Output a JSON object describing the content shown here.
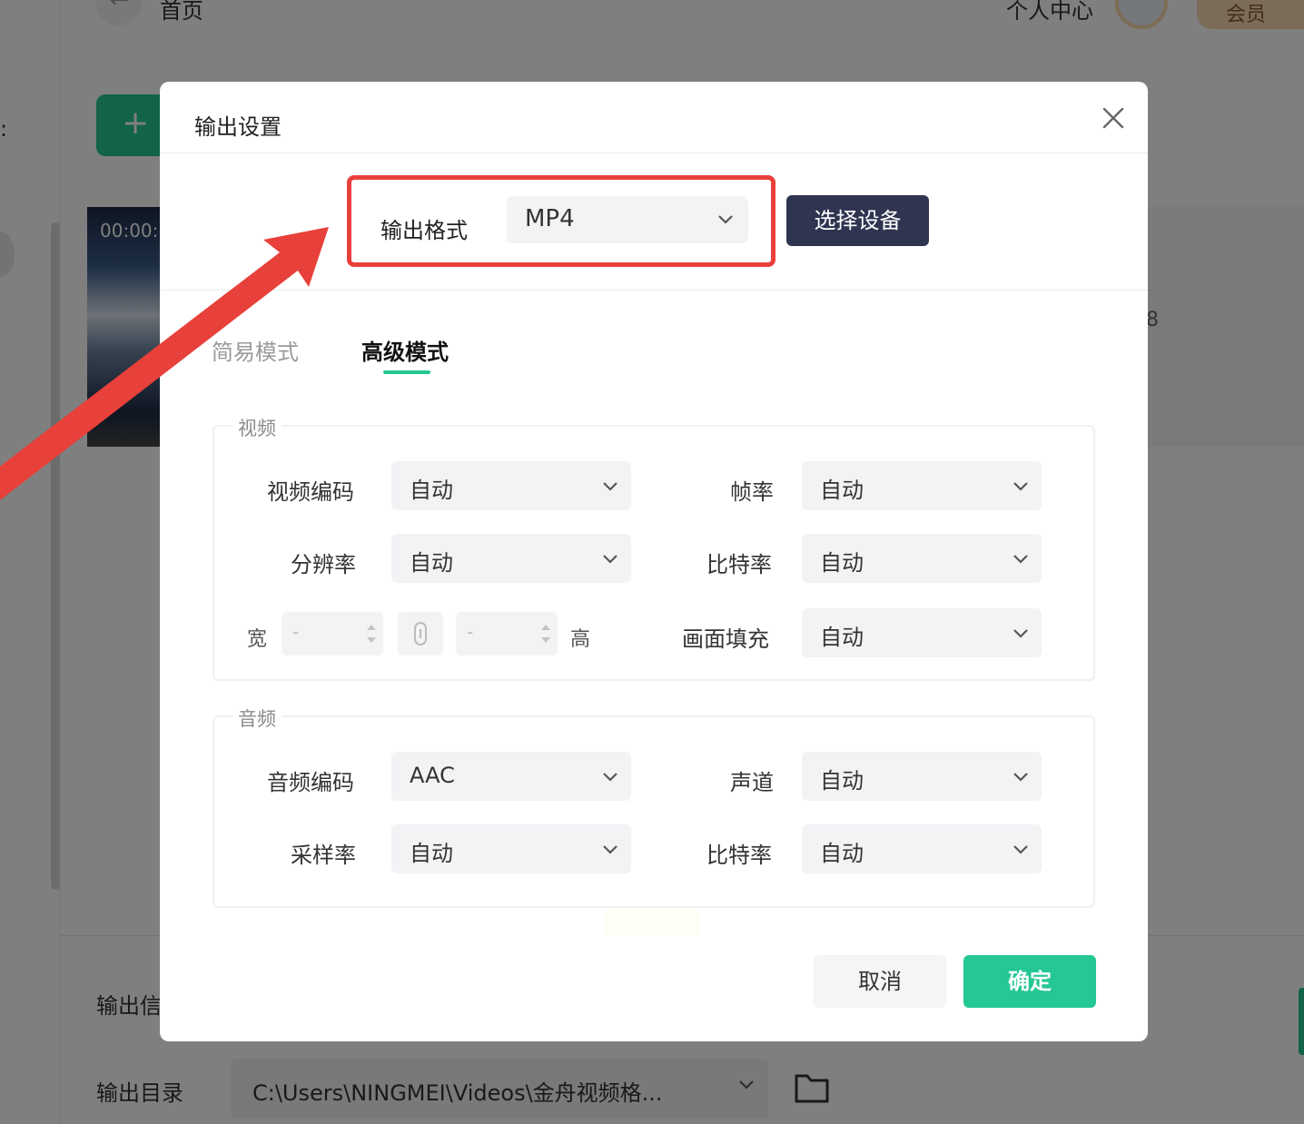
{
  "background": {
    "home_label": "首页",
    "user_center_label": "个人中心",
    "vip_label": "会员",
    "add_button_label": "+",
    "thumb_time": "00:00:",
    "row_number": "8",
    "output_info_label": "输出信",
    "output_dir_label": "输出目录",
    "output_dir_value": "C:\\Users\\NINGMEI\\Videos\\金舟视频格..."
  },
  "dialog": {
    "title": "输出设置",
    "format_label": "输出格式",
    "format_value": "MP4",
    "device_button": "选择设备",
    "tabs": [
      {
        "label": "简易模式",
        "active": false
      },
      {
        "label": "高级模式",
        "active": true
      }
    ],
    "video": {
      "group_label": "视频",
      "codec_label": "视频编码",
      "codec_value": "自动",
      "framerate_label": "帧率",
      "framerate_value": "自动",
      "resolution_label": "分辨率",
      "resolution_value": "自动",
      "bitrate_label": "比特率",
      "bitrate_value": "自动",
      "width_label": "宽",
      "width_value": "-",
      "height_label": "高",
      "height_value": "-",
      "fill_label": "画面填充",
      "fill_value": "自动"
    },
    "audio": {
      "group_label": "音频",
      "codec_label": "音频编码",
      "codec_value": "AAC",
      "channel_label": "声道",
      "channel_value": "自动",
      "samplerate_label": "采样率",
      "samplerate_value": "自动",
      "bitrate_label": "比特率",
      "bitrate_value": "自动"
    },
    "cancel_button": "取消",
    "confirm_button": "确定"
  },
  "colors": {
    "accent_green": "#25c794",
    "device_button_bg": "#2f3450",
    "highlight_red": "#e8403a"
  }
}
